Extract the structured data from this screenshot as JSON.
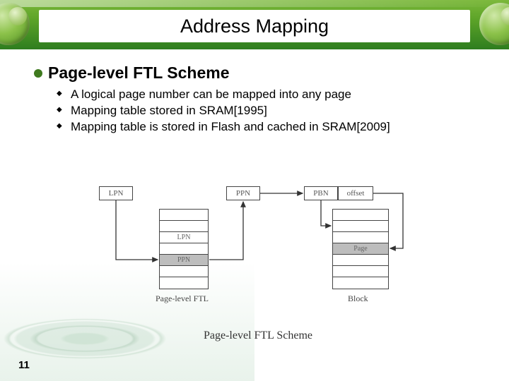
{
  "slide": {
    "title": "Address Mapping",
    "page_number": "11"
  },
  "section": {
    "heading": "Page-level FTL Scheme",
    "bullets": [
      "A logical page number can be mapped into any page",
      "Mapping table stored in SRAM[1995]",
      "Mapping table is stored in Flash and cached in SRAM[2009]"
    ]
  },
  "diagram": {
    "lpn_box": "LPN",
    "ppn_box": "PPN",
    "pbn_box": "PBN",
    "offset_box": "offset",
    "ftl_table": {
      "header": "LPN",
      "row_ppn": "PPN",
      "label": "Page-level FTL"
    },
    "block_table": {
      "row_page": "Page",
      "label": "Block"
    },
    "caption": "Page-level FTL Scheme"
  }
}
